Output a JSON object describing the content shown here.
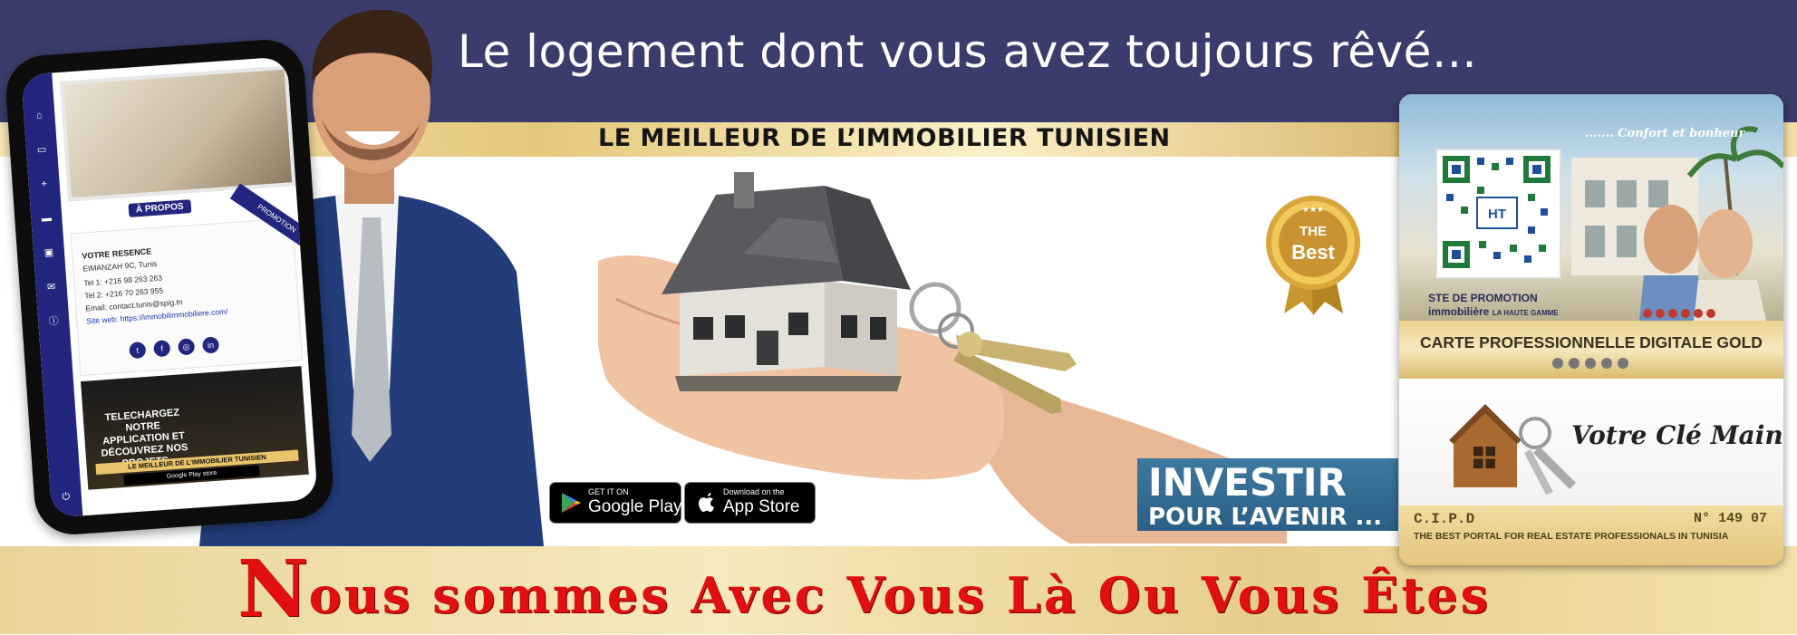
{
  "header": {
    "headline": "Le logement dont vous avez toujours rêvé…",
    "tagline": "LE MEILLEUR DE L’IMMOBILIER TUNISIEN"
  },
  "phone": {
    "apropos_label": "À PROPOS",
    "promotion_label": "PROMOTION",
    "card": {
      "title": "VOTRE RESENCE",
      "address": "EIMANZAH 9C, Tunis",
      "tel1": "Tel 1:   +216 98 263 263",
      "tel2": "Tel 2:   +216 70 263 955",
      "email": "Email:   contact.tunis@spig.tn",
      "site": "Site web:   https://immobilimmobiliere.com/"
    },
    "ad": {
      "text": "TELECHARGEZ NOTRE APPLICATION ET DÉCOUVREZ NOS PROJETS",
      "strip": "LE MEILLEUR DE L’IMMOBILIER TUNISIEN",
      "play": "Google Play store"
    }
  },
  "badge": {
    "top": "THE",
    "bottom": "Best"
  },
  "stores": {
    "google_small": "GET IT ON",
    "google_big": "Google Play",
    "apple_small": "Download on the",
    "apple_big": "App Store"
  },
  "investir": {
    "line1": "INVESTIR",
    "line2": "POUR L’AVENIR ..."
  },
  "right_card": {
    "confort": "....... Confort et bonheur",
    "qr_label": "HT",
    "ste": "STE DE PROMOTION",
    "immo": "immobilière",
    "immo_small": "LA HAUTE GAMME",
    "gold_title": "CARTE PROFESSIONNELLE DIGITALE GOLD",
    "script": "Votre Clé Main",
    "cipd": "C.I.P.D",
    "number": "N° 149 07",
    "portal": "THE BEST PORTAL FOR REAL ESTATE PROFESSIONALS IN TUNISIA"
  },
  "footer": {
    "slogan_first": "N",
    "slogan_rest": "ous sommes Avec Vous Là Ou Vous Êtes"
  },
  "colors": {
    "navy": "#3a3d6b",
    "gold": "#e5c87a",
    "slogan_red": "#e01010",
    "phone_blue": "#23267e",
    "investir_blue": "#2b5f86"
  }
}
